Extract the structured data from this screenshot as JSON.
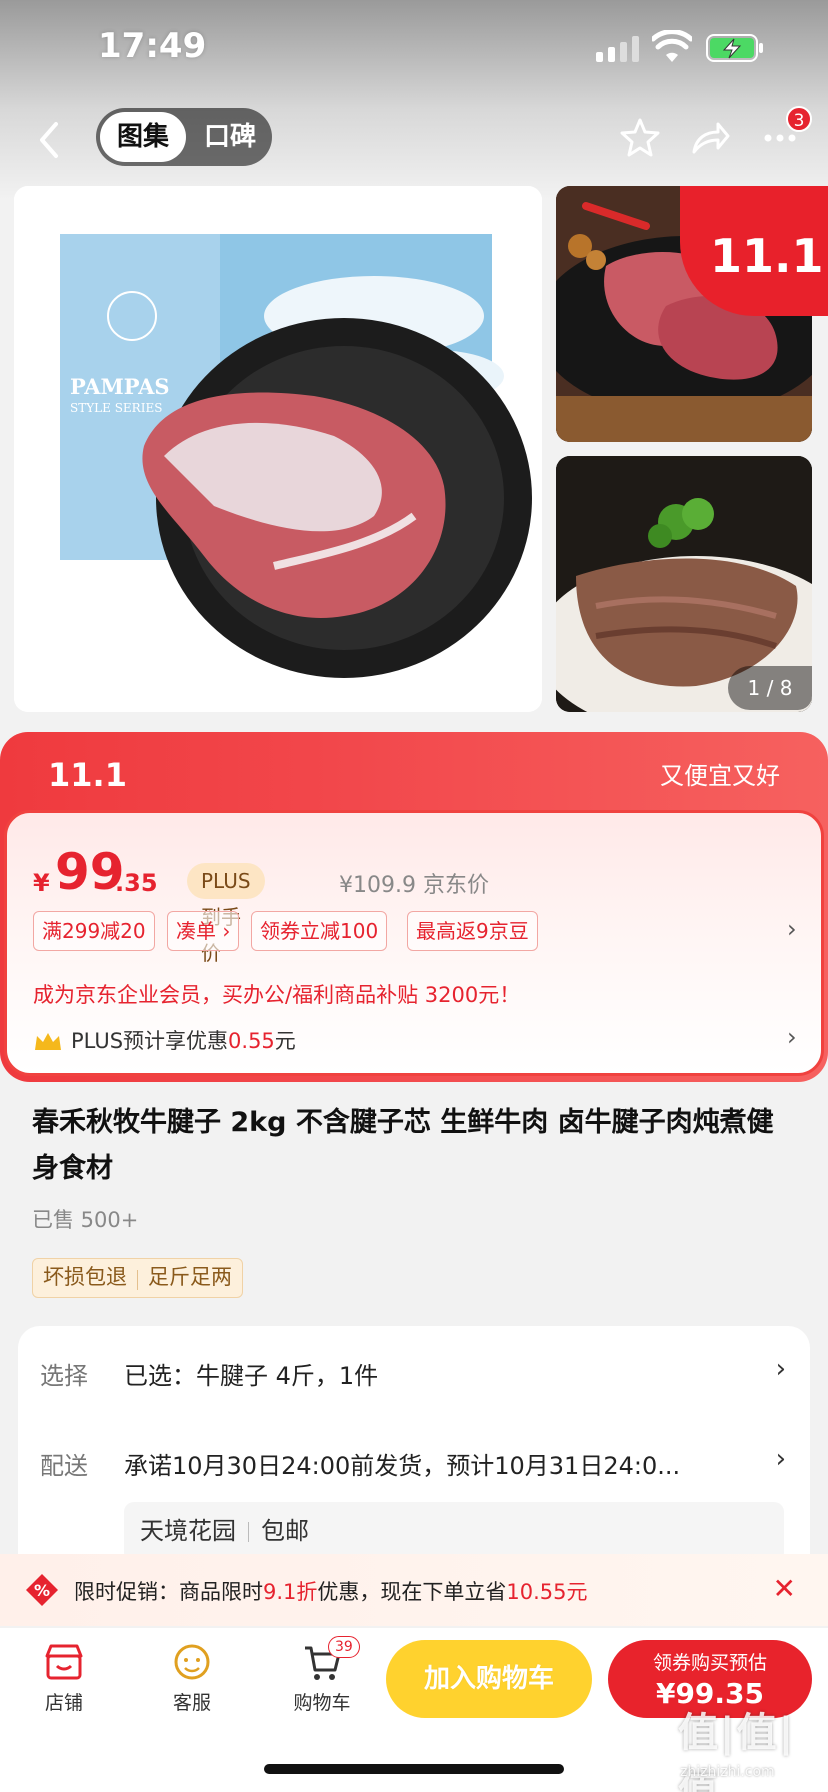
{
  "status": {
    "time": "17:49"
  },
  "nav": {
    "tabs": [
      {
        "label": "图集",
        "active": true
      },
      {
        "label": "口碑",
        "active": false
      }
    ],
    "more_badge": "3"
  },
  "gallery": {
    "page": "1 / 8",
    "main_image": "beef-shank-pampas-package",
    "thumbs": [
      "beef-on-plate",
      "sliced-braised-beef"
    ]
  },
  "promo": {
    "slogan": "又便宜又好",
    "accent": "#e6232f",
    "price_symbol": "¥",
    "price_int": "99",
    "price_dec": ".35",
    "plus_tag": "PLUS到手价",
    "orig_price": "¥109.9 京东价",
    "coupons": [
      "满299减20",
      "凑单 ›",
      "领券立减100",
      "最高返9京豆"
    ],
    "biz_line": "成为京东企业会员，买办公/福利商品补贴 3200元！",
    "plus_prefix": "PLUS预计享优惠",
    "plus_amount": "0.55",
    "plus_unit": "元"
  },
  "product": {
    "title": "春禾秋牧牛腱子 2kg 不含腱子芯 生鲜牛肉 卤牛腱子肉炖煮健身食材",
    "sold": "已售 500+",
    "tags": [
      "坏损包退",
      "足斤足两"
    ]
  },
  "spec": {
    "select_label": "选择",
    "select_value": "已选：牛腱子 4斤，1件",
    "delivery_label": "配送",
    "delivery_value": "承诺10月30日24:00前发货，预计10月31日24:0...",
    "addr_name": "天境花园",
    "addr_ship": "包邮"
  },
  "limit": {
    "prefix": "限时促销：商品限时",
    "discount": "9.1折",
    "middle": "优惠，现在下单立省",
    "save": "10.55元"
  },
  "bottom": {
    "store": "店铺",
    "service": "客服",
    "cart": "购物车",
    "cart_count": "39",
    "add_cart": "加入购物车",
    "buy_top": "领券购买预估",
    "buy_price": "¥99.35"
  },
  "watermark": {
    "main": "值|值|值",
    "sub": "zhizhizhi.com"
  }
}
